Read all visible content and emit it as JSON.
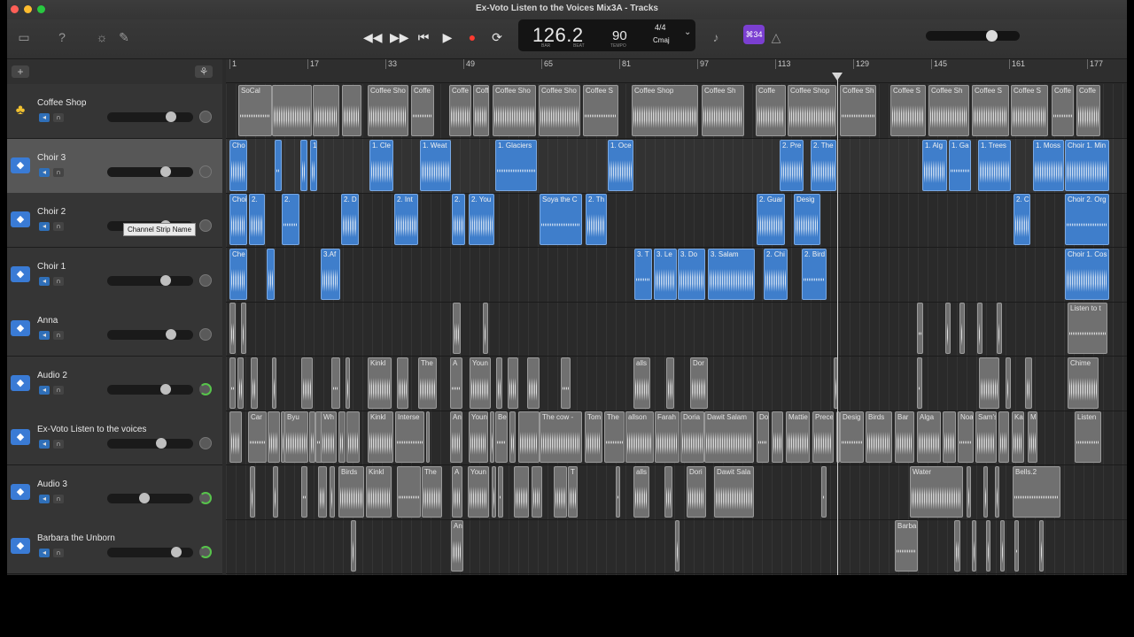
{
  "window": {
    "title": "Ex-Voto Listen to the Voices Mix3A - Tracks"
  },
  "lcd": {
    "position": "126.2",
    "position_label": "BAR",
    "beat_label": "BEAT",
    "tempo": "90",
    "tempo_label": "TEMPO",
    "signature": "4/4",
    "key": "Cmaj"
  },
  "badge": "⌘34",
  "tooltip": "Channel Strip Name",
  "ruler": [
    "1",
    "17",
    "33",
    "49",
    "65",
    "81",
    "97",
    "113",
    "129",
    "145",
    "161",
    "177"
  ],
  "tracks": [
    {
      "name": "Coffee Shop",
      "type": "drummer",
      "selected": false,
      "volume": 0.78,
      "pan_green": false
    },
    {
      "name": "Choir 3",
      "type": "audio",
      "selected": true,
      "volume": 0.7,
      "pan_green": false
    },
    {
      "name": "Choir 2",
      "type": "audio",
      "selected": false,
      "volume": 0.7,
      "pan_green": false
    },
    {
      "name": "Choir 1",
      "type": "audio",
      "selected": false,
      "volume": 0.7,
      "pan_green": false
    },
    {
      "name": "Anna",
      "type": "audio",
      "selected": false,
      "volume": 0.78,
      "pan_green": false
    },
    {
      "name": "Audio 2",
      "type": "audio",
      "selected": false,
      "volume": 0.7,
      "pan_green": true
    },
    {
      "name": "Ex-Voto Listen to the voices",
      "type": "audio",
      "selected": false,
      "volume": 0.65,
      "pan_green": false
    },
    {
      "name": "Audio 3",
      "type": "audio",
      "selected": false,
      "volume": 0.42,
      "pan_green": true
    },
    {
      "name": "Barbara the Unborn",
      "type": "audio",
      "selected": false,
      "volume": 0.85,
      "pan_green": true
    }
  ],
  "regions": [
    [
      [
        "SoCal",
        14,
        38
      ],
      [
        "",
        52,
        45
      ],
      [
        "",
        98,
        30
      ],
      [
        "",
        131,
        22
      ],
      [
        "Coffee Sho",
        160,
        46
      ],
      [
        "Coffe",
        209,
        26
      ],
      [
        "Coffe",
        252,
        25
      ],
      [
        "Coff",
        279,
        18
      ],
      [
        "Coffee Sho",
        301,
        49
      ],
      [
        "Coffee Sho",
        353,
        47
      ],
      [
        "Coffee S",
        403,
        40
      ],
      [
        "Coffee Shop",
        458,
        75
      ],
      [
        "Coffee Sh",
        537,
        48
      ],
      [
        "Coffe",
        598,
        34
      ],
      [
        "Coffee Shop",
        634,
        55
      ],
      [
        "Coffee Sh",
        693,
        41
      ],
      [
        "Coffee S",
        750,
        40
      ],
      [
        "Coffee Sh",
        793,
        46
      ],
      [
        "Coffee S",
        842,
        42
      ],
      [
        "Coffee S",
        886,
        42
      ],
      [
        "Coffe",
        932,
        25
      ],
      [
        "Coffe",
        960,
        27
      ]
    ],
    [
      [
        "Cho",
        4,
        20
      ],
      [
        "",
        55,
        8
      ],
      [
        "",
        84,
        8
      ],
      [
        "1.",
        95,
        8
      ],
      [
        "1. Cle",
        162,
        27
      ],
      [
        "1. Weat",
        219,
        35
      ],
      [
        "1. Glaciers",
        304,
        47
      ],
      [
        "1. Oce",
        431,
        29
      ],
      [
        "2. Pre",
        625,
        27
      ],
      [
        "2. The",
        660,
        29
      ],
      [
        "1. Alg",
        786,
        28
      ],
      [
        "1. Ga",
        816,
        25
      ],
      [
        "1. Trees",
        849,
        37
      ],
      [
        "1. Moss",
        911,
        35
      ],
      [
        "Choir 1. Min",
        947,
        50
      ]
    ],
    [
      [
        "Choi",
        4,
        20
      ],
      [
        "2.",
        26,
        18
      ],
      [
        "2.",
        63,
        20
      ],
      [
        "2. D",
        130,
        20
      ],
      [
        "2. Int",
        190,
        27
      ],
      [
        "2.",
        255,
        15
      ],
      [
        "2. You",
        274,
        29
      ],
      [
        "Soya the C",
        354,
        48
      ],
      [
        "2. Th",
        406,
        24
      ],
      [
        "2. Guar",
        599,
        32
      ],
      [
        "Desig",
        641,
        30
      ],
      [
        "2. C",
        889,
        19
      ],
      [
        "Choir 2. Org",
        947,
        50
      ]
    ],
    [
      [
        "Che",
        4,
        20
      ],
      [
        "",
        46,
        9
      ],
      [
        "3.Af",
        107,
        22
      ],
      [
        "3. T",
        461,
        20
      ],
      [
        "3. Le",
        483,
        26
      ],
      [
        "3. Do",
        510,
        31
      ],
      [
        "3. Salam",
        544,
        53
      ],
      [
        "2. Chi",
        607,
        27
      ],
      [
        "2. Bird",
        650,
        28
      ],
      [
        "Choir 1. Cos",
        947,
        50
      ]
    ],
    [
      [
        "",
        4,
        7
      ],
      [
        "",
        17,
        6
      ],
      [
        "",
        256,
        9
      ],
      [
        "",
        290,
        6
      ],
      [
        "",
        780,
        7
      ],
      [
        "",
        812,
        6
      ],
      [
        "",
        828,
        6
      ],
      [
        "",
        848,
        6
      ],
      [
        "",
        870,
        6
      ],
      [
        "Listen to t",
        950,
        45
      ]
    ],
    [
      [
        "",
        4,
        7
      ],
      [
        "",
        13,
        7
      ],
      [
        "",
        28,
        8
      ],
      [
        "",
        52,
        5
      ],
      [
        "",
        85,
        13
      ],
      [
        "",
        119,
        10
      ],
      [
        "",
        135,
        5
      ],
      [
        "Kinkl",
        160,
        27
      ],
      [
        "",
        193,
        13
      ],
      [
        "The",
        217,
        21
      ],
      [
        "A",
        253,
        14
      ],
      [
        "Youn",
        275,
        24
      ],
      [
        "",
        305,
        7
      ],
      [
        "",
        318,
        12
      ],
      [
        "",
        340,
        14
      ],
      [
        "",
        378,
        11
      ],
      [
        "alls",
        460,
        19
      ],
      [
        "",
        497,
        9
      ],
      [
        "Dor",
        524,
        20
      ],
      [
        "",
        686,
        5
      ],
      [
        "",
        780,
        6
      ],
      [
        "",
        850,
        23
      ],
      [
        "",
        880,
        6
      ],
      [
        "",
        902,
        8
      ],
      [
        "Chime",
        950,
        35
      ]
    ],
    [
      [
        "",
        4,
        14
      ],
      [
        "Car",
        25,
        21
      ],
      [
        "",
        47,
        14
      ],
      [
        "",
        62,
        5
      ],
      [
        "Byu",
        66,
        27
      ],
      [
        "",
        94,
        7
      ],
      [
        "",
        101,
        9
      ],
      [
        "Wh",
        107,
        18
      ],
      [
        "",
        127,
        8
      ],
      [
        "",
        136,
        15
      ],
      [
        "Kinkl",
        160,
        29
      ],
      [
        "Interse",
        191,
        33
      ],
      [
        "",
        226,
        4
      ],
      [
        "An",
        253,
        14
      ],
      [
        "Youn",
        274,
        22
      ],
      [
        "",
        298,
        5
      ],
      [
        "Be",
        304,
        14
      ],
      [
        "",
        320,
        7
      ],
      [
        "",
        330,
        24
      ],
      [
        "The cow -",
        354,
        48
      ],
      [
        "Tom",
        405,
        20
      ],
      [
        "The",
        427,
        23
      ],
      [
        "allson",
        451,
        32
      ],
      [
        "Farah",
        484,
        28
      ],
      [
        "Doria",
        513,
        27
      ],
      [
        "Dawit Salam",
        540,
        56
      ],
      [
        "Do",
        599,
        14
      ],
      [
        "",
        616,
        13
      ],
      [
        "Mattie",
        632,
        27
      ],
      [
        "Prece",
        662,
        24
      ],
      [
        "",
        689,
        4
      ],
      [
        "Desig",
        693,
        27
      ],
      [
        "Birds",
        722,
        30
      ],
      [
        "Bar",
        755,
        22
      ],
      [
        "Alga",
        780,
        27
      ],
      [
        "",
        809,
        15
      ],
      [
        "Noa",
        826,
        18
      ],
      [
        "Sam's",
        846,
        24
      ],
      [
        "",
        872,
        12
      ],
      [
        "Ka",
        887,
        14
      ],
      [
        "M",
        905,
        11
      ],
      [
        "Listen",
        958,
        30
      ]
    ],
    [
      [
        "",
        27,
        6
      ],
      [
        "",
        53,
        6
      ],
      [
        "",
        85,
        7
      ],
      [
        "",
        104,
        10
      ],
      [
        "",
        117,
        6
      ],
      [
        "Birds",
        127,
        29
      ],
      [
        "Kinkl",
        158,
        29
      ],
      [
        "",
        193,
        27
      ],
      [
        "The",
        221,
        23
      ],
      [
        "A",
        255,
        12
      ],
      [
        "Youn",
        273,
        24
      ],
      [
        "",
        300,
        5
      ],
      [
        "",
        307,
        6
      ],
      [
        "",
        325,
        17
      ],
      [
        "",
        345,
        12
      ],
      [
        "",
        370,
        15
      ],
      [
        "T",
        386,
        11
      ],
      [
        "",
        440,
        5
      ],
      [
        "alls",
        460,
        18
      ],
      [
        "",
        495,
        9
      ],
      [
        "Dori",
        520,
        22
      ],
      [
        "Dawit Sala",
        551,
        45
      ],
      [
        "",
        672,
        6
      ],
      [
        "Water",
        772,
        60
      ],
      [
        "",
        836,
        5
      ],
      [
        "",
        855,
        5
      ],
      [
        "",
        868,
        5
      ],
      [
        "Bells.2",
        888,
        54
      ]
    ],
    [
      [
        "",
        141,
        6
      ],
      [
        "An",
        254,
        14
      ],
      [
        "",
        507,
        5
      ],
      [
        "Barba",
        755,
        26
      ],
      [
        "",
        822,
        7
      ],
      [
        "",
        842,
        5
      ],
      [
        "",
        858,
        5
      ],
      [
        "",
        874,
        5
      ],
      [
        "",
        890,
        5
      ],
      [
        "",
        918,
        5
      ]
    ]
  ]
}
